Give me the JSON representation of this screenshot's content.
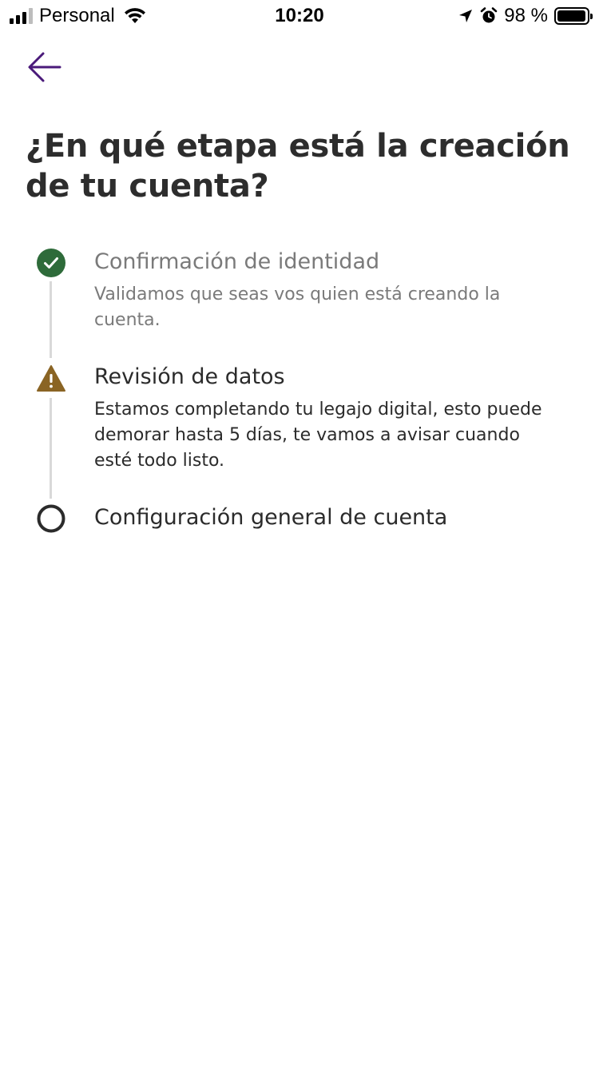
{
  "status_bar": {
    "carrier": "Personal",
    "time": "10:20",
    "battery_text": "98 %",
    "battery_level": 0.98
  },
  "header": {
    "back_icon": "arrow-left-icon",
    "title": "¿En qué etapa está la creación de tu cuenta?"
  },
  "colors": {
    "accent": "#4a1a7a",
    "success": "#2e6b3a",
    "warning": "#8a6424",
    "pending": "#2b2b2b",
    "line": "#d9d9d9"
  },
  "steps": [
    {
      "status": "completed",
      "icon": "check-circle-icon",
      "title": "Confirmación de identidad",
      "description": "Validamos que seas vos quien está creando la cuenta."
    },
    {
      "status": "warning",
      "icon": "warning-triangle-icon",
      "title": "Revisión de datos",
      "description": "Estamos completando tu legajo digital, esto puede demorar hasta 5 días, te vamos a avisar cuando esté todo listo."
    },
    {
      "status": "pending",
      "icon": "empty-circle-icon",
      "title": "Configuración general de cuenta",
      "description": ""
    }
  ]
}
